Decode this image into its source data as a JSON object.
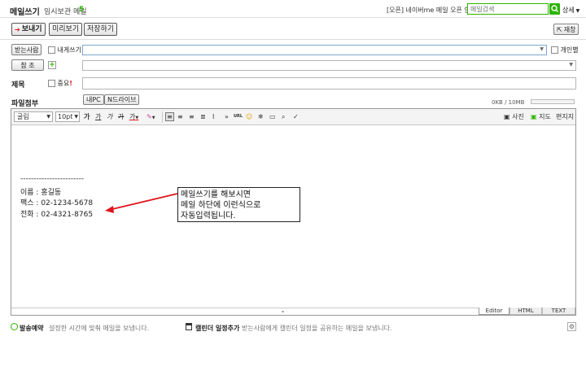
{
  "header": {
    "title": "메일쓰기",
    "draft_label": "임시보관 메일",
    "draft_count": "5",
    "notice": "[오픈] 네이버me 메일 오픈 안내",
    "search_placeholder": "메일검색",
    "detail_label": "상세"
  },
  "toolbar": {
    "send": "보내기",
    "preview": "미리보기",
    "save": "저장하기",
    "reserve": "재창"
  },
  "fields": {
    "to_button": "받는사람",
    "to_self": "내게쓰기",
    "personal": "개인별",
    "cc_button": "참 조",
    "subject_label": "제목",
    "important": "중요",
    "important_mark": "!",
    "attach_label": "파일첨부",
    "attach_pc": "내PC",
    "attach_ndrive": "N드라이브",
    "size_text": "0KB / 10MB"
  },
  "editor": {
    "font": "굴림",
    "size": "10pt",
    "photo": "사진",
    "map": "지도",
    "edit": "편지지",
    "url": "URL",
    "tabs": [
      "Editor",
      "HTML",
      "TEXT"
    ]
  },
  "signature": {
    "divider": "------------------------",
    "name": "이름 : 홍길동",
    "fax": "팩스 : 02-1234-5678",
    "phone": "전화 : 02-4321-8765"
  },
  "annotation": {
    "line1": "메일쓰기를 해보시면",
    "line2": "메일 하단에 이런식으로",
    "line3": "자동입력됩니다."
  },
  "footer": {
    "schedule_label": "발송예약",
    "schedule_desc": "설정한 시간에 맞춰 메일을 보냅니다.",
    "calendar_label": "캘린더 일정추가",
    "calendar_desc": "받는사람에게 캘린더 일정을 공유하는 메일을 보냅니다."
  },
  "colors": {
    "accent_green": "#2db400",
    "arrow_red": "#e0141b"
  }
}
